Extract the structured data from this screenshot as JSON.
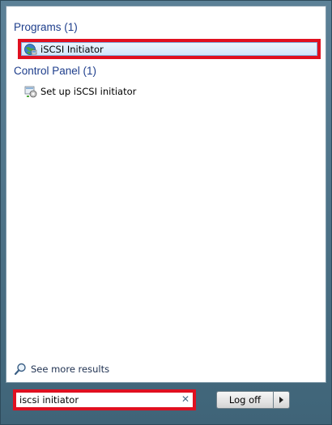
{
  "results": {
    "programs": {
      "header": "Programs (1)",
      "items": [
        {
          "label": "iSCSI Initiator",
          "icon": "iscsi-globe-icon"
        }
      ]
    },
    "control_panel": {
      "header": "Control Panel (1)",
      "items": [
        {
          "label": "Set up iSCSI initiator",
          "icon": "control-panel-task-icon"
        }
      ]
    },
    "see_more": "See more results"
  },
  "search": {
    "value": "iscsi initiator",
    "clear_glyph": "✕"
  },
  "power": {
    "logoff_label": "Log off"
  },
  "colors": {
    "highlight_border": "#e01020",
    "group_header": "#1e3e8c",
    "frame": "#4a6d80"
  }
}
